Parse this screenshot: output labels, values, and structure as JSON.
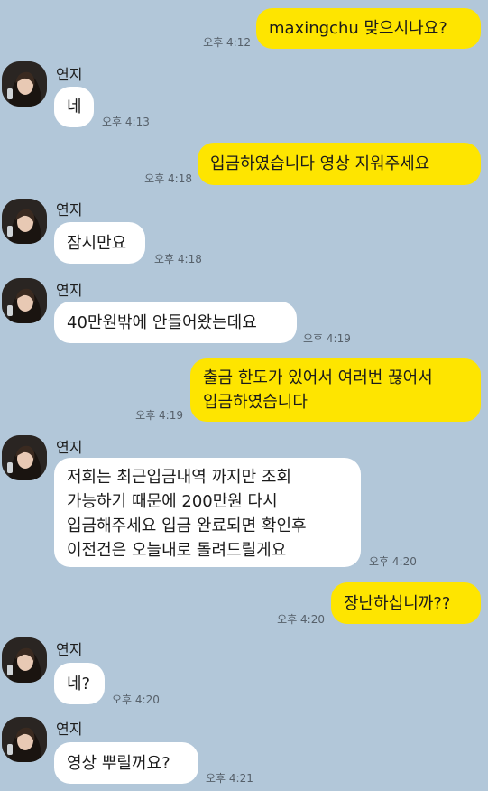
{
  "contact": {
    "name": "연지"
  },
  "messages": [
    {
      "dir": "out",
      "text": "maxingchu 맞으시나요?",
      "time": "오후 4:12"
    },
    {
      "dir": "in",
      "text": "네",
      "time": "오후 4:13"
    },
    {
      "dir": "out",
      "text": "입금하였습니다  영상 지워주세요",
      "time": "오후 4:18"
    },
    {
      "dir": "in",
      "text": "잠시만요",
      "time": "오후 4:18"
    },
    {
      "dir": "in",
      "text": "40만원밖에 안들어왔는데요",
      "time": "오후 4:19"
    },
    {
      "dir": "out",
      "text": "출금 한도가 있어서 여러번 끊어서\n입금하였습니다",
      "time": "오후 4:19"
    },
    {
      "dir": "in",
      "text": "저희는 최근입금내역 까지만 조회\n가능하기 때문에 200만원 다시\n입금해주세요 입금 완료되면 확인후\n이전건은 오늘내로 돌려드릴게요",
      "time": "오후 4:20"
    },
    {
      "dir": "out",
      "text": "장난하십니까??",
      "time": "오후 4:20"
    },
    {
      "dir": "in",
      "text": "네?",
      "time": "오후 4:20"
    },
    {
      "dir": "in",
      "text": "영상 뿌릴꺼요?",
      "time": "오후 4:21"
    }
  ]
}
